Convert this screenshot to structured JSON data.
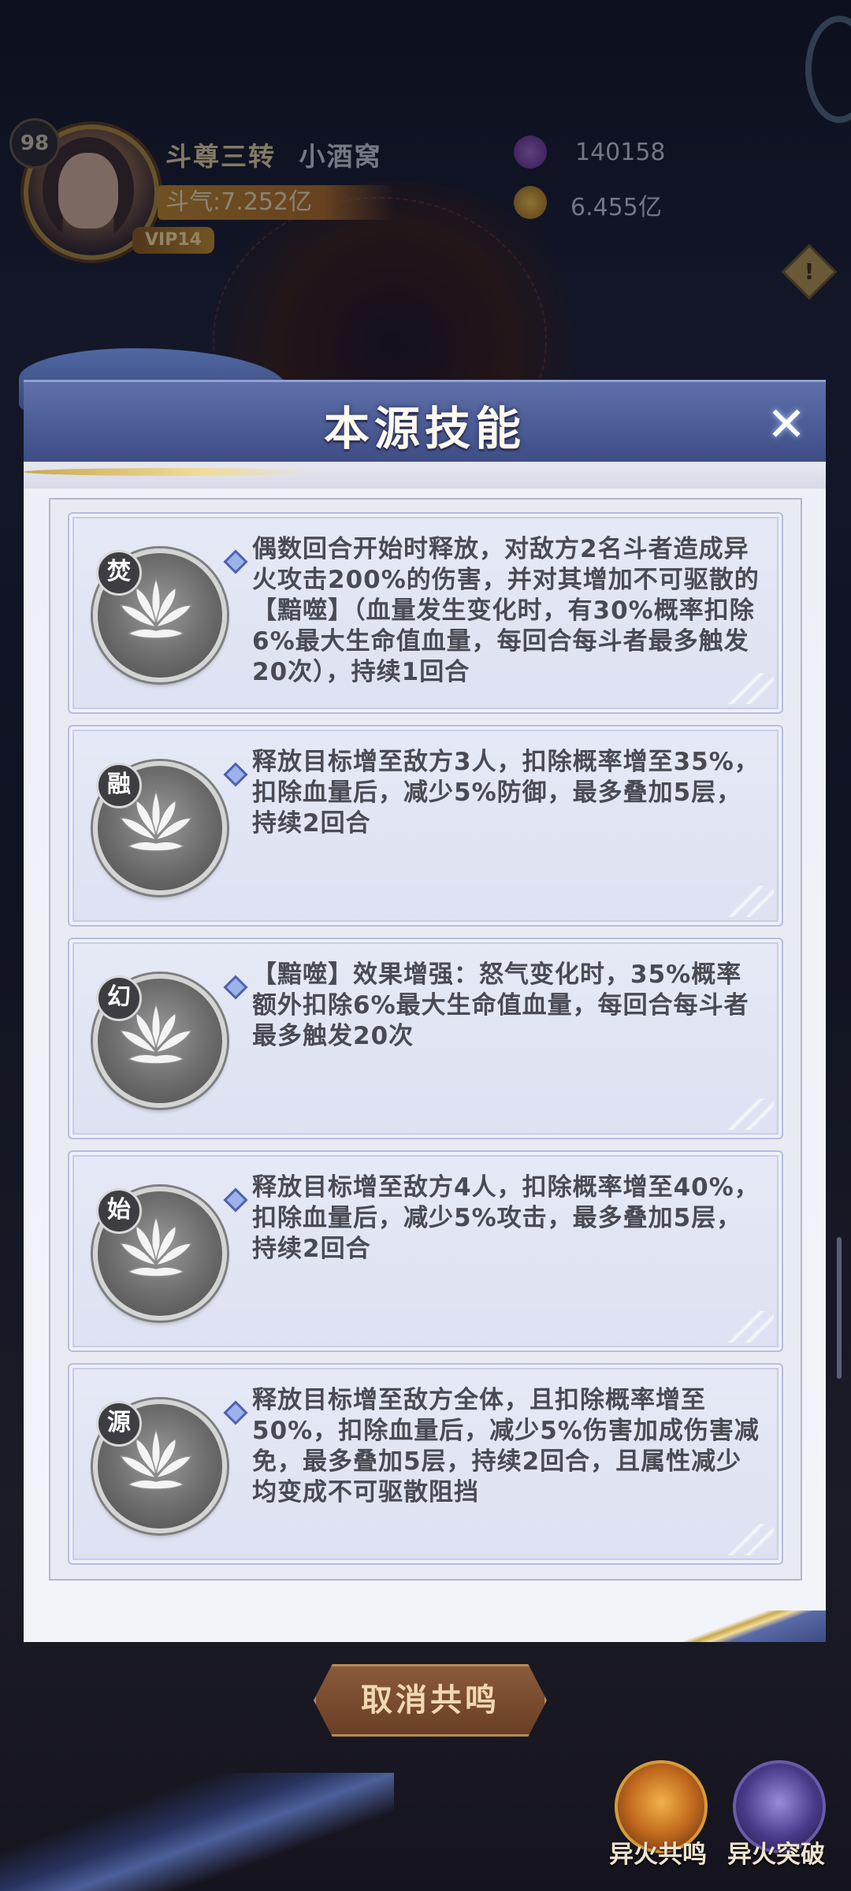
{
  "player": {
    "level": "98",
    "title": "斗尊三转",
    "name": "小酒窝",
    "vip": "VIP14",
    "power": "斗气:7.252亿",
    "currency_1": "140158",
    "currency_2": "6.455亿"
  },
  "modal": {
    "title": "本源技能",
    "close_label": "✕",
    "skills": [
      {
        "rank": "焚",
        "description": "偶数回合开始时释放，对敌方2名斗者造成异火攻击200%的伤害，并对其增加不可驱散的【黯噬】（血量发生变化时，有30%概率扣除6%最大生命值血量，每回合每斗者最多触发20次），持续1回合"
      },
      {
        "rank": "融",
        "description": "释放目标增至敌方3人，扣除概率增至35%，扣除血量后，减少5%防御，最多叠加5层，持续2回合"
      },
      {
        "rank": "幻",
        "description": "【黯噬】效果增强：怒气变化时，35%概率额外扣除6%最大生命值血量，每回合每斗者最多触发20次"
      },
      {
        "rank": "始",
        "description": "释放目标增至敌方4人，扣除概率增至40%，扣除血量后，减少5%攻击，最多叠加5层，持续2回合"
      },
      {
        "rank": "源",
        "description": "释放目标增至敌方全体，且扣除概率增至50%，扣除血量后，减少5%伤害加成伤害减免，最多叠加5层，持续2回合，且属性减少均变成不可驱散阻挡"
      }
    ]
  },
  "buttons": {
    "cancel": "取消共鸣",
    "resonance": "异火共鸣",
    "breakthrough": "异火突破"
  },
  "icons": {
    "close": "close-icon",
    "skill_medal": "lotus-icon",
    "bullet": "diamond-bullet-icon",
    "warning": "warning-icon"
  },
  "colors": {
    "header": "#4a5a93",
    "card_bg": "#dde1f1",
    "text": "#4a4a55",
    "bullet": "#4f62b0"
  }
}
